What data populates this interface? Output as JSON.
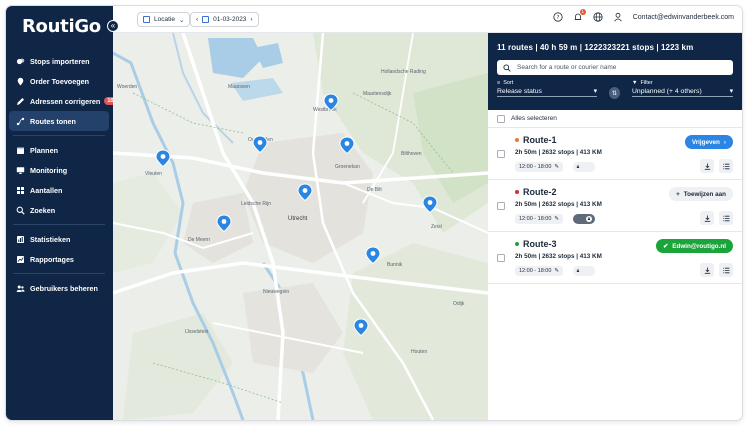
{
  "app": {
    "logo_text": "RoutiGo"
  },
  "sidebar": {
    "items": [
      {
        "label": "Stops importeren",
        "icon": "stops-import-icon"
      },
      {
        "label": "Order Toevoegen",
        "icon": "order-add-icon"
      },
      {
        "label": "Adressen corrigeren",
        "icon": "pencil-icon",
        "badge": "10"
      },
      {
        "label": "Routes tonen",
        "icon": "route-icon",
        "active": true
      },
      {
        "label": "Plannen",
        "icon": "planner-icon"
      },
      {
        "label": "Monitoring",
        "icon": "monitor-icon"
      },
      {
        "label": "Aantallen",
        "icon": "grid-icon"
      },
      {
        "label": "Zoeken",
        "icon": "search-icon"
      },
      {
        "label": "Statistieken",
        "icon": "statistics-icon"
      },
      {
        "label": "Rapportages",
        "icon": "chart-icon"
      },
      {
        "label": "Gebruikers beheren",
        "icon": "users-icon"
      }
    ]
  },
  "topbar": {
    "location_label": "Locatie",
    "date": "01-03-2023",
    "notification_count": "1",
    "user_email": "Contact@edwinvanderbeek.com"
  },
  "map": {
    "labels": [
      "Woerden",
      "Maarssen",
      "Westbroek",
      "Oud-Zuilen",
      "Groenekan",
      "Maartensdijk",
      "De Bilt",
      "Zeist",
      "Bunnik",
      "Utrecht",
      "Leidsche Rijn",
      "De Meern",
      "Vleuten",
      "Houten",
      "Nieuwegein",
      "IJsselstein",
      "Bilthoven",
      "Odijk",
      "Hollandsche Rading"
    ]
  },
  "panel": {
    "summary": "11 routes | 40 h 59 m | 1222323221 stops | 1223 km",
    "search_placeholder": "Search for a route or courier name",
    "sort_label": "Sort",
    "sort_value": "Release status",
    "filter_label": "Filter",
    "filter_value": "Unplanned (+ 4 others)",
    "select_all": "Alles selecteren",
    "routes": [
      {
        "name": "Route-1",
        "color": "#f07a2a",
        "meta": "2h 50m | 2632 stops | 413 KM",
        "time": "12:00 - 18:00",
        "action": "Vrijgeven",
        "action_style": "blue",
        "locked": false
      },
      {
        "name": "Route-2",
        "color": "#d62b2b",
        "meta": "2h 50m | 2632 stops | 413 KM",
        "time": "12:00 - 18:00",
        "action": "Toewijzen aan",
        "action_style": "grey",
        "locked": true
      },
      {
        "name": "Route-3",
        "color": "#1aa43a",
        "meta": "2h 50m | 2632 stops | 413 KM",
        "time": "12:00 - 18:00",
        "action": "Edwin@routigo.nl",
        "action_style": "green",
        "locked": false
      }
    ]
  },
  "colors": {
    "navy": "#0f2646",
    "accent": "#2b86e3",
    "marker": "#2b86e3"
  }
}
